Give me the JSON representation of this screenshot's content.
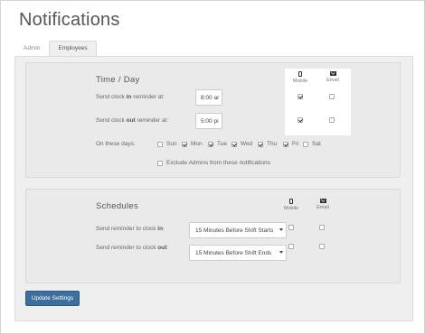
{
  "page": {
    "title": "Notifications"
  },
  "tabs": [
    {
      "label": "Admin",
      "active": false
    },
    {
      "label": "Employees",
      "active": true
    }
  ],
  "time_day": {
    "title": "Time / Day",
    "columns": {
      "mobile": "Mobile",
      "email": "Email"
    },
    "clock_in": {
      "prefix": "Send clock ",
      "bold": "in",
      "suffix": " reminder at:",
      "time": "8:00 ar",
      "mobile": true,
      "email": false
    },
    "clock_out": {
      "prefix": "Send clock ",
      "bold": "out",
      "suffix": " reminder at:",
      "time": "5:00 pi",
      "mobile": true,
      "email": false
    },
    "days_label": "On these days:",
    "days": [
      {
        "label": "Sun",
        "checked": false
      },
      {
        "label": "Mon",
        "checked": true
      },
      {
        "label": "Tue",
        "checked": true
      },
      {
        "label": "Wed",
        "checked": true
      },
      {
        "label": "Thu",
        "checked": true
      },
      {
        "label": "Fri",
        "checked": true
      },
      {
        "label": "Sat",
        "checked": false
      }
    ],
    "exclude_admins": {
      "label": "Exclude Admins from these notifications",
      "checked": false
    }
  },
  "schedules": {
    "title": "Schedules",
    "columns": {
      "mobile": "Mobile",
      "email": "Email"
    },
    "clock_in": {
      "prefix": "Send reminder to clock ",
      "bold": "in",
      "suffix": ":",
      "selected": "15 Minutes Before Shift Starts",
      "mobile": false,
      "email": false
    },
    "clock_out": {
      "prefix": "Send reminder to clock ",
      "bold": "out",
      "suffix": ":",
      "selected": "15 Minutes Before Shift Ends",
      "mobile": false,
      "email": false
    }
  },
  "actions": {
    "update_label": "Update Settings"
  },
  "icons": {
    "mobile": "phone-icon",
    "email": "envelope-icon"
  },
  "colors": {
    "primary_button": "#3d6f9e",
    "panel_bg": "#efefef",
    "highlight_bg": "#ffffff"
  }
}
